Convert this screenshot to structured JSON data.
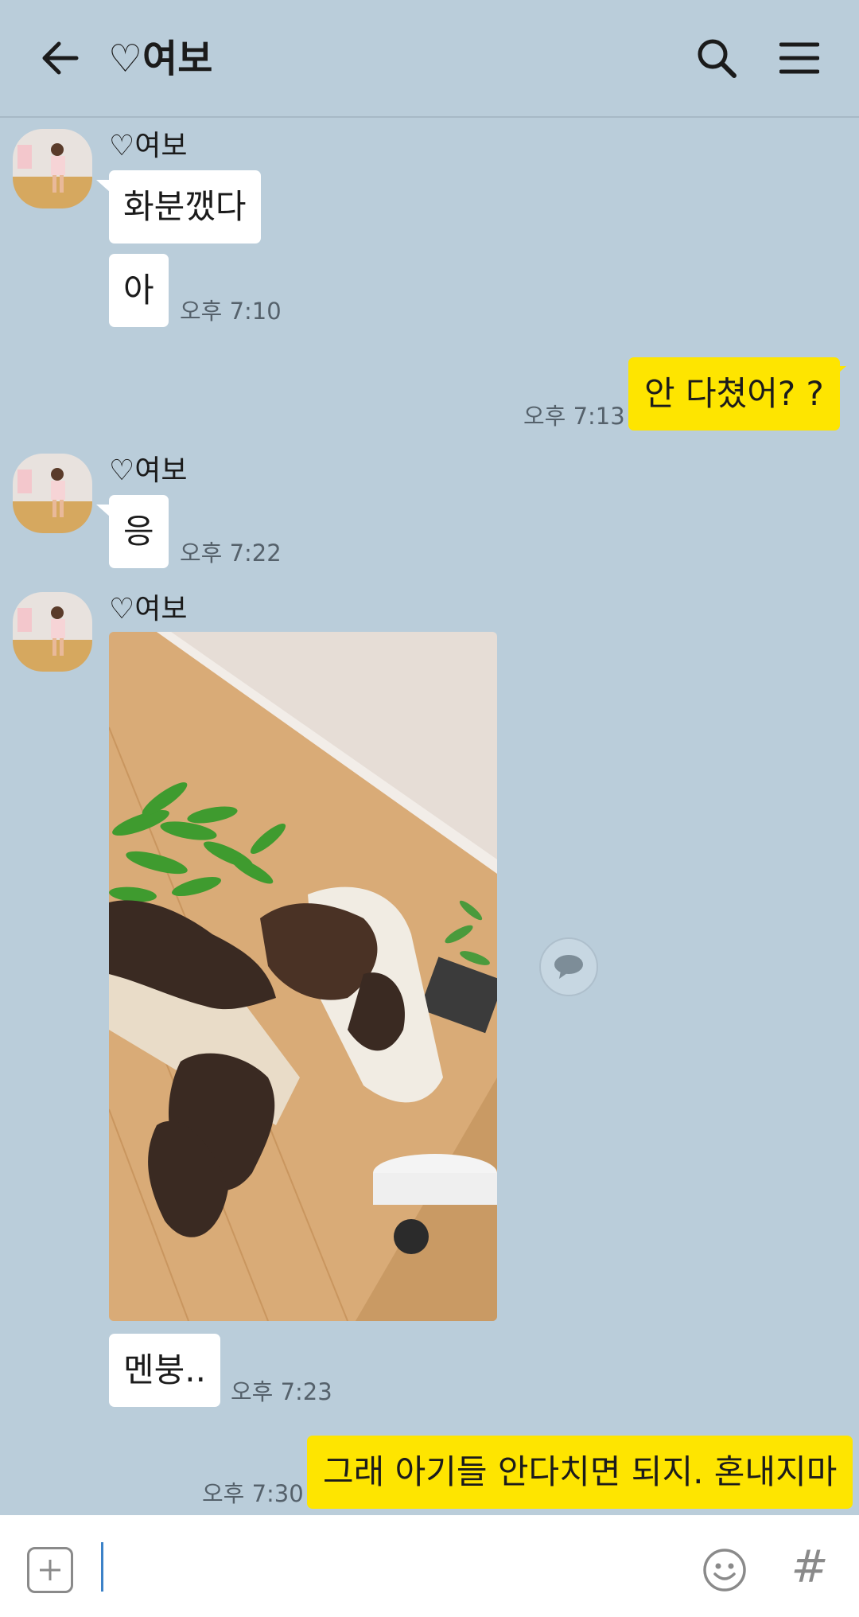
{
  "header": {
    "title": "♡여보"
  },
  "messages": [
    {
      "sender": "♡여보",
      "text": "화분깼다"
    },
    {
      "text": "아",
      "time": "오후 7:10"
    },
    {
      "text": "안 다쳤어? ?",
      "time": "오후 7:13"
    },
    {
      "sender": "♡여보",
      "text": "응",
      "time": "오후 7:22"
    },
    {
      "sender": "♡여보"
    },
    {
      "text": "멘붕..",
      "time": "오후 7:23"
    },
    {
      "text": "그래 아기들 안다치면 되지. 혼내지마",
      "time": "오후 7:30"
    }
  ],
  "colors": {
    "background": "#bacdda",
    "incoming_bubble": "#ffffff",
    "outgoing_bubble": "#fee500"
  },
  "icons": {
    "back": "arrow-left-icon",
    "search": "search-icon",
    "menu": "hamburger-menu-icon",
    "share": "speech-bubble-icon",
    "attach": "plus-square-icon",
    "emoji": "smiley-icon",
    "hashtag": "#"
  },
  "input": {
    "value": ""
  }
}
